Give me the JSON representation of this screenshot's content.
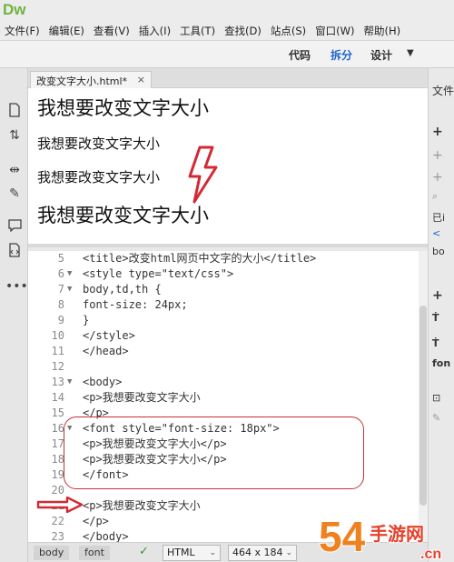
{
  "app": {
    "logo": "Dw"
  },
  "menu": [
    "文件(F)",
    "编辑(E)",
    "查看(V)",
    "插入(I)",
    "工具(T)",
    "查找(D)",
    "站点(S)",
    "窗口(W)",
    "帮助(H)"
  ],
  "view": {
    "code": "代码",
    "split": "拆分",
    "design": "设计",
    "active": "split"
  },
  "document_tab": {
    "label": "改变文字大小.html*",
    "close": "×"
  },
  "design_view": {
    "lines": [
      {
        "text": "我想要改变文字大小",
        "size": "24px"
      },
      {
        "text": "我想要改变文字大小",
        "size": "18px"
      },
      {
        "text": "我想要改变文字大小",
        "size": "18px"
      },
      {
        "text": "我想要改变文字大小",
        "size": "24px"
      }
    ]
  },
  "code_view": {
    "lines": [
      {
        "num": "5",
        "fold": "",
        "text": "<title>改变html网页中文字的大小</title>"
      },
      {
        "num": "6",
        "fold": "▼",
        "text": "<style type=\"text/css\">"
      },
      {
        "num": "7",
        "fold": "▼",
        "text": "body,td,th {"
      },
      {
        "num": "8",
        "fold": "",
        "text": "    font-size: 24px;"
      },
      {
        "num": "9",
        "fold": "",
        "text": "}"
      },
      {
        "num": "10",
        "fold": "",
        "text": "</style>"
      },
      {
        "num": "11",
        "fold": "",
        "text": "</head>"
      },
      {
        "num": "12",
        "fold": "",
        "text": ""
      },
      {
        "num": "13",
        "fold": "▼",
        "text": "<body>"
      },
      {
        "num": "14",
        "fold": "",
        "text": "<p>我想要改变文字大小"
      },
      {
        "num": "15",
        "fold": "",
        "text": "</p>"
      },
      {
        "num": "16",
        "fold": "▼",
        "text": "    <font style=\"font-size: 18px\">"
      },
      {
        "num": "17",
        "fold": "",
        "text": "<p>我想要改变文字大小</p>"
      },
      {
        "num": "18",
        "fold": "",
        "text": "<p>我想要改变文字大小</p>"
      },
      {
        "num": "19",
        "fold": "",
        "text": "        </font>"
      },
      {
        "num": "20",
        "fold": "",
        "text": ""
      },
      {
        "num": "21",
        "fold": "",
        "text": "<p>我想要改变文字大小"
      },
      {
        "num": "22",
        "fold": "",
        "text": "</p>"
      },
      {
        "num": "23",
        "fold": "",
        "text": "</body>"
      }
    ]
  },
  "status": {
    "tags": [
      "body",
      "font"
    ],
    "doctype": "HTML",
    "window_size": "464 x 184"
  },
  "right_panel": {
    "files_label": "文件",
    "item_a": "已i",
    "item_b": "< ",
    "item_c": "bo",
    "item_d": "fon"
  },
  "annotation": {
    "highlight_color": "#c8303c"
  },
  "watermark": {
    "text": "54",
    "sub": "手游网",
    "url": ".cn"
  }
}
